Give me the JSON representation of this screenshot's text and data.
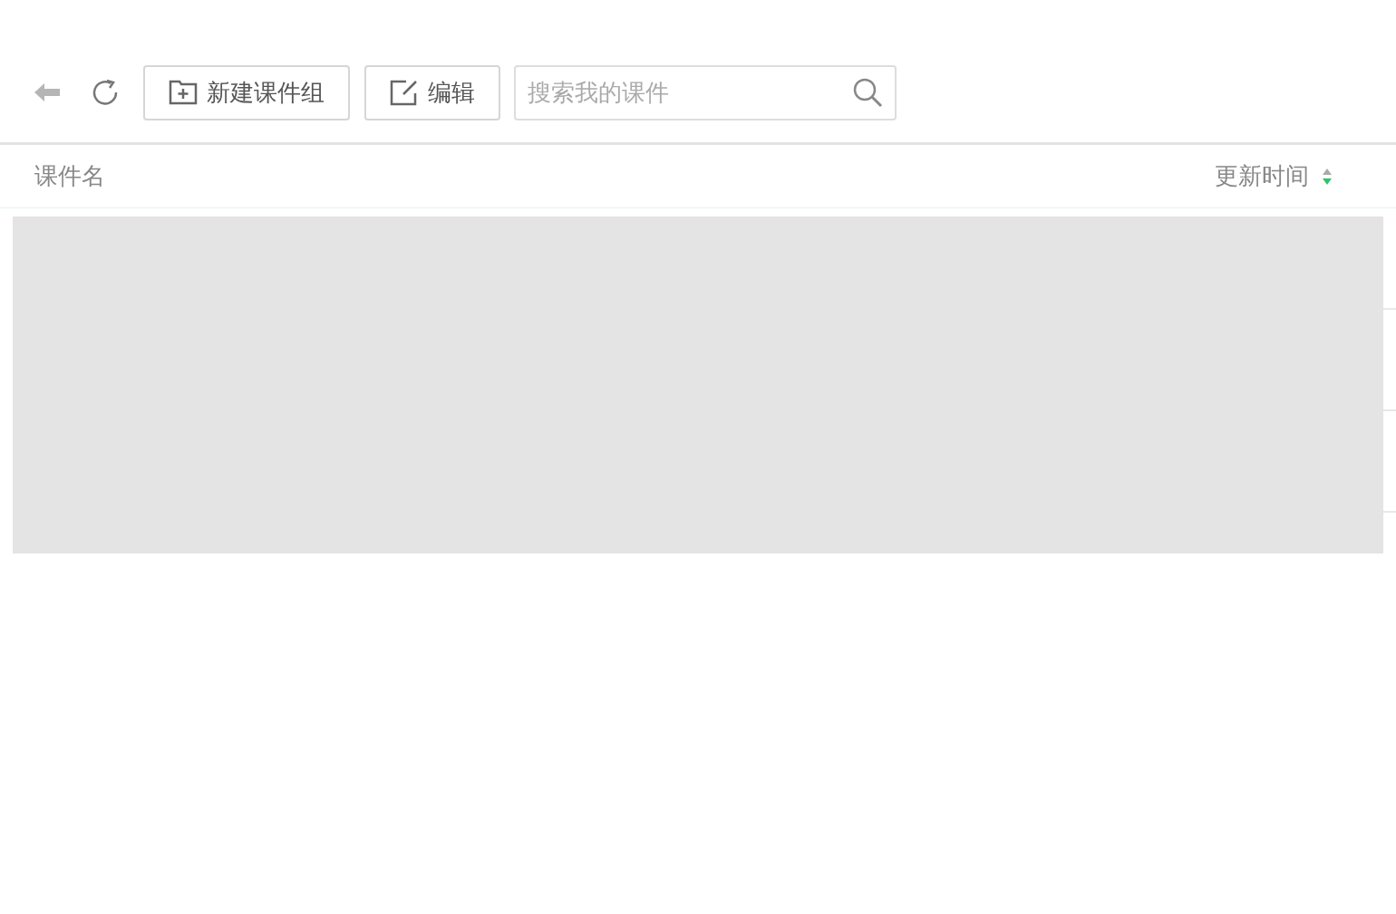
{
  "toolbar": {
    "buttons": [
      {
        "kind": "new-group",
        "label": "新建课件组"
      },
      {
        "kind": "edit",
        "label": "编辑"
      }
    ],
    "search": {
      "placeholder": "搜索我的课件"
    }
  },
  "table": {
    "columns": [
      {
        "label": "课件名"
      },
      {
        "label": "更新时间",
        "sort_descending": true
      }
    ]
  }
}
